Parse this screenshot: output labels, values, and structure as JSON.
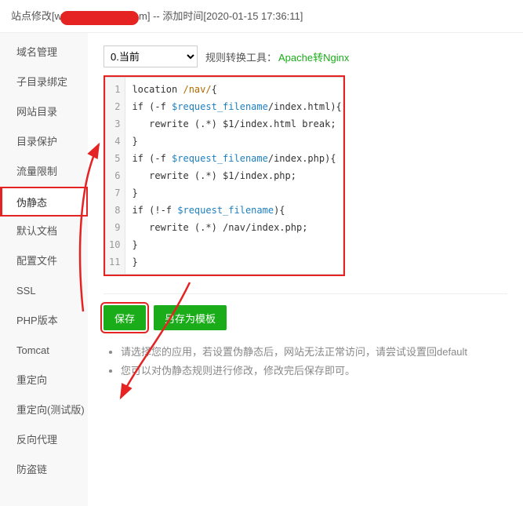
{
  "header": {
    "prefix": "站点修改[w",
    "suffix_after_redact": "m] -- 添加时间[2020-01-15 17:36:11]"
  },
  "sidebar": {
    "items": [
      {
        "label": "域名管理"
      },
      {
        "label": "子目录绑定"
      },
      {
        "label": "网站目录"
      },
      {
        "label": "目录保护"
      },
      {
        "label": "流量限制"
      },
      {
        "label": "伪静态",
        "active": true
      },
      {
        "label": "默认文档"
      },
      {
        "label": "配置文件"
      },
      {
        "label": "SSL"
      },
      {
        "label": "PHP版本"
      },
      {
        "label": "Tomcat"
      },
      {
        "label": "重定向"
      },
      {
        "label": "重定向(测试版)"
      },
      {
        "label": "反向代理"
      },
      {
        "label": "防盗链"
      }
    ]
  },
  "toolbar": {
    "select_value": "0.当前",
    "tool_label": "规则转换工具：",
    "tool_link": "Apache转Nginx"
  },
  "code": {
    "lines": [
      {
        "n": 1,
        "segs": [
          {
            "t": "location ",
            "c": "kw"
          },
          {
            "t": "/nav/",
            "c": "path"
          },
          {
            "t": "{"
          }
        ]
      },
      {
        "n": 2,
        "segs": [
          {
            "t": "if (-f ",
            "c": "kw"
          },
          {
            "t": "$request_filename",
            "c": "var"
          },
          {
            "t": "/index.html){",
            "c": "kw"
          }
        ]
      },
      {
        "n": 3,
        "segs": [
          {
            "t": "   rewrite (.*) $1/index.html break;",
            "c": "kw"
          }
        ]
      },
      {
        "n": 4,
        "segs": [
          {
            "t": "}"
          }
        ]
      },
      {
        "n": 5,
        "segs": [
          {
            "t": "if (-f ",
            "c": "kw"
          },
          {
            "t": "$request_filename",
            "c": "var"
          },
          {
            "t": "/index.php){",
            "c": "kw"
          }
        ]
      },
      {
        "n": 6,
        "segs": [
          {
            "t": "   rewrite (.*) $1/index.php;",
            "c": "kw"
          }
        ]
      },
      {
        "n": 7,
        "segs": [
          {
            "t": "}"
          }
        ]
      },
      {
        "n": 8,
        "segs": [
          {
            "t": "if (!-f ",
            "c": "kw"
          },
          {
            "t": "$request_filename",
            "c": "var"
          },
          {
            "t": "){",
            "c": "kw"
          }
        ]
      },
      {
        "n": 9,
        "segs": [
          {
            "t": "   rewrite (.*) /nav/index.php;",
            "c": "kw"
          }
        ]
      },
      {
        "n": 10,
        "segs": [
          {
            "t": "}"
          }
        ]
      },
      {
        "n": 11,
        "segs": [
          {
            "t": "}"
          }
        ]
      }
    ]
  },
  "buttons": {
    "save": "保存",
    "save_as": "另存为模板"
  },
  "tips": [
    "请选择您的应用，若设置伪静态后，网站无法正常访问，请尝试设置回default",
    "您可以对伪静态规则进行修改，修改完后保存即可。"
  ]
}
